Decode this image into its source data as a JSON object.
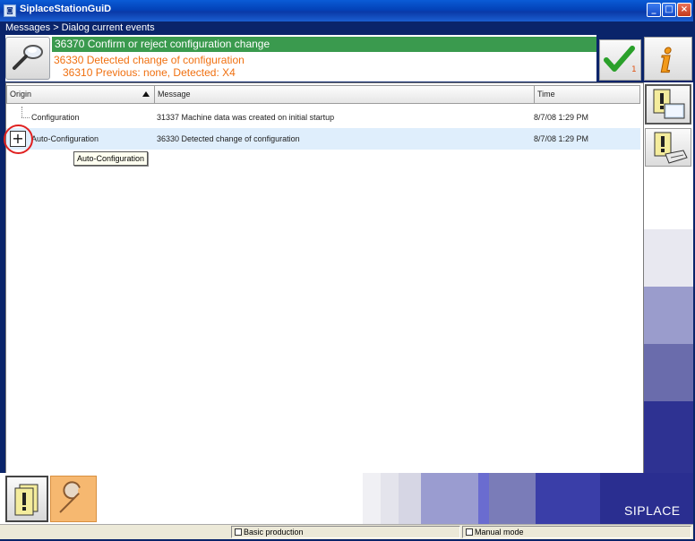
{
  "window": {
    "title": "SiplaceStationGuiD",
    "min_label": "_",
    "max_label": "□",
    "close_label": "×"
  },
  "breadcrumb": "Messages > Dialog current events",
  "header": {
    "msg_primary": "36370 Confirm or reject configuration change",
    "msg_secondary": "36330 Detected change of configuration",
    "msg_tertiary": "36310 Previous: none, Detected: X4",
    "confirm_count": "1"
  },
  "table": {
    "columns": [
      "Origin",
      "Message",
      "Time"
    ],
    "rows": [
      {
        "origin": "Configuration",
        "message": "31337 Machine data was created on initial startup",
        "time": "8/7/08 1:29 PM"
      },
      {
        "origin": "Auto-Configuration",
        "message": "36330 Detected change of configuration",
        "time": "8/7/08 1:29 PM"
      }
    ],
    "expand_label": "+",
    "tooltip": "Auto-Configuration"
  },
  "brand": "SIPLACE",
  "status": {
    "production": "Basic production",
    "mode": "Manual mode"
  },
  "colors": {
    "title_bar": "#0342b8",
    "highlight_green": "#3a9a4e",
    "warning_orange": "#f07010",
    "selected_row": "#dfeefc",
    "brand_blue": "#2a2e90"
  }
}
